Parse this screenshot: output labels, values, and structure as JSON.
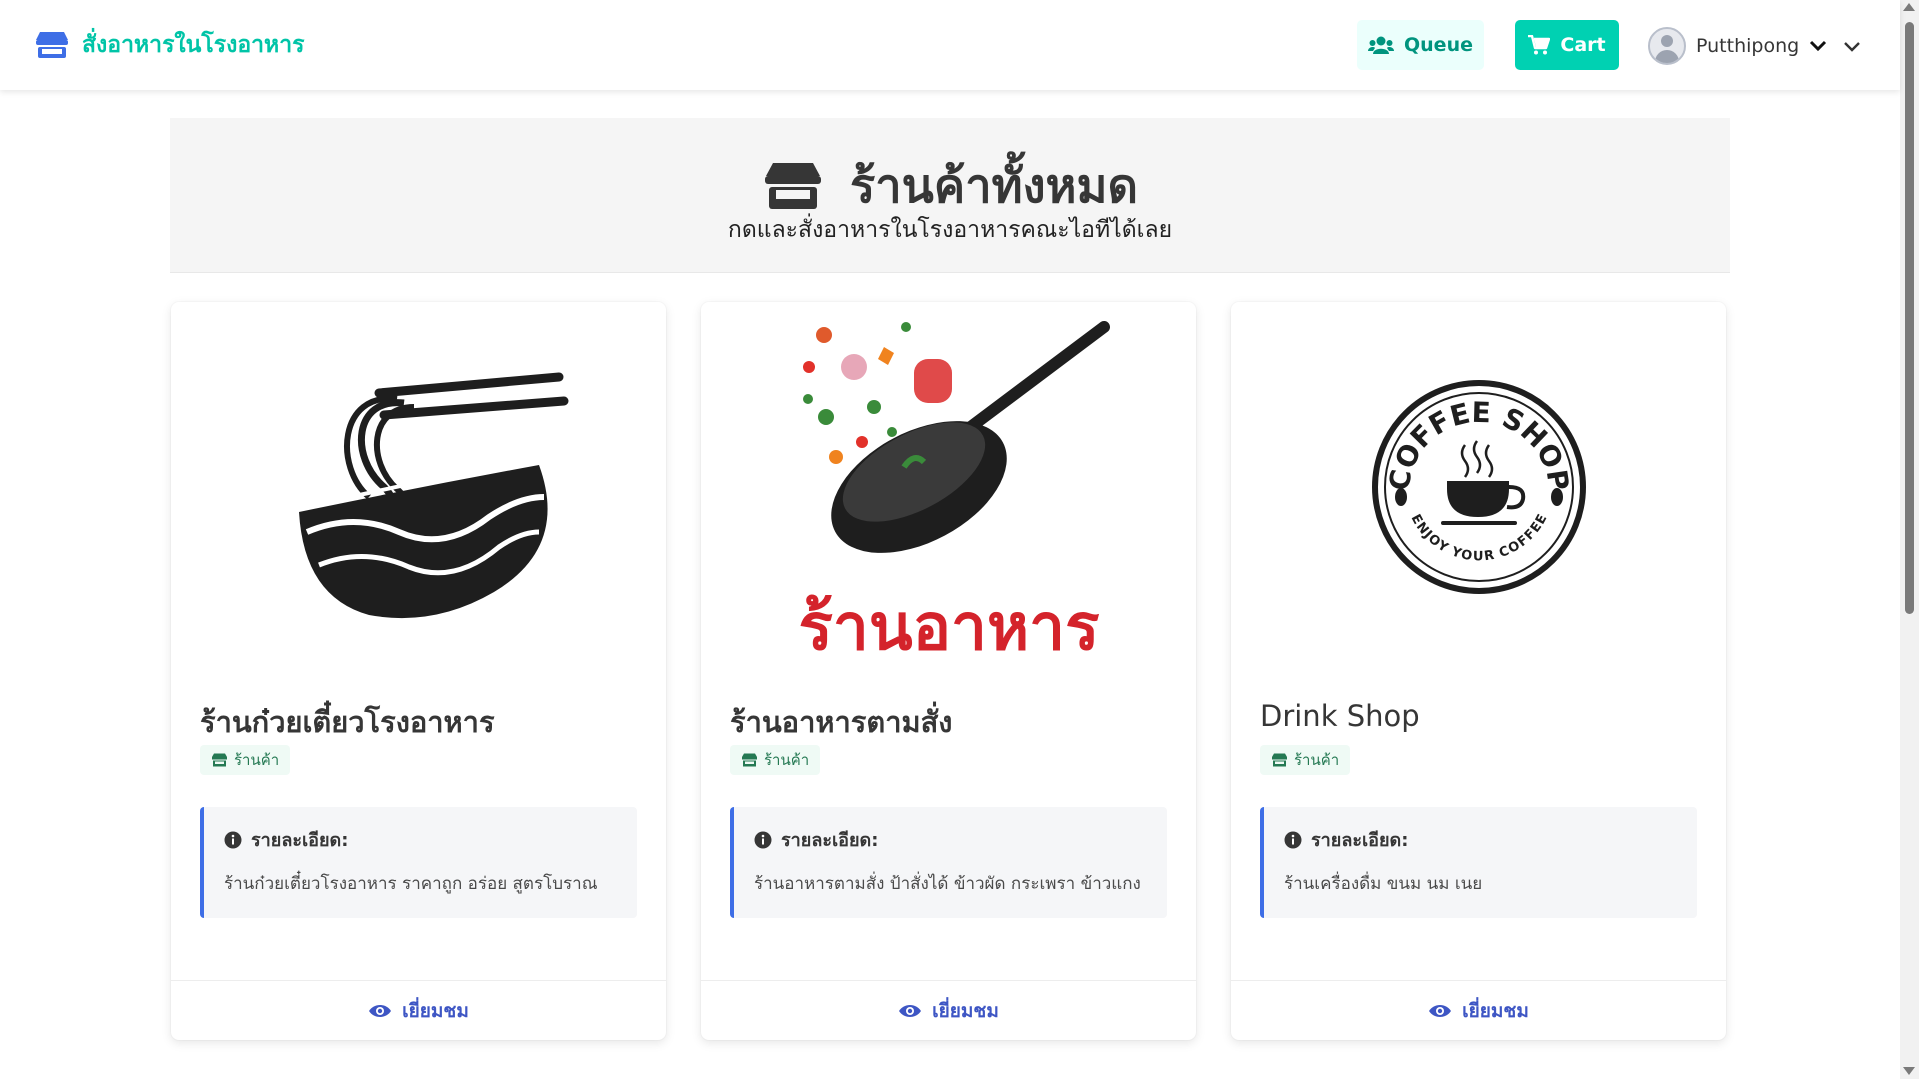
{
  "navbar": {
    "brand": "สั่งอาหารในโรงอาหาร",
    "queue_label": "Queue",
    "cart_label": "Cart",
    "user_name": "Putthipong",
    "colors": {
      "brand": "#00c4a7",
      "primary": "#00d1b2",
      "link": "#3e56c4"
    }
  },
  "hero": {
    "title": "ร้านค้าทั้งหมด",
    "subtitle": "กดและสั่งอาหารในโรงอาหารคณะไอทีได้เลย"
  },
  "cards": [
    {
      "title": "ร้านก๋วยเตี๋ยวโรงอาหาร",
      "tag": "ร้านค้า",
      "desc_label": "รายละเอียด:",
      "description": "ร้านก๋วยเตี๋ยวโรงอาหาร ราคาถูก อร่อย สูตรโบราณ",
      "action": "เยี่ยมชม",
      "image": "noodle-bowl-logo"
    },
    {
      "title": "ร้านอาหารตามสั่ง",
      "tag": "ร้านค้า",
      "desc_label": "รายละเอียด:",
      "description": "ร้านอาหารตามสั่ง ป้าสั่งได้ ข้าวผัด กระเพรา ข้าวแกง",
      "action": "เยี่ยมชม",
      "image": "wok-restaurant-logo",
      "image_text": "ร้านอาหาร"
    },
    {
      "title": "Drink Shop",
      "tag": "ร้านค้า",
      "desc_label": "รายละเอียด:",
      "description": "ร้านเครื่องดื่ม ขนม นม เนย",
      "action": "เยี่ยมชม",
      "image": "coffee-shop-logo",
      "image_text_top": "COFFEE SHOP",
      "image_text_bottom": "ENJOY YOUR COFFEE"
    }
  ]
}
